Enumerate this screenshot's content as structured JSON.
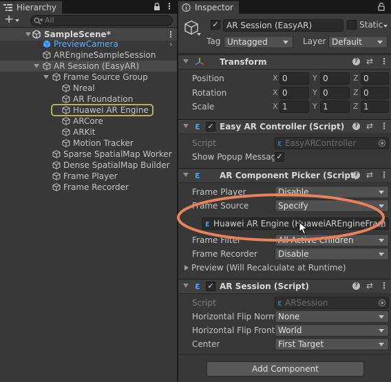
{
  "hierarchy": {
    "tab_label": "Hierarchy",
    "search_placeholder": "All",
    "add_label": "+",
    "scene_name": "SampleScene*",
    "items": [
      {
        "label": "PreviewCamera"
      },
      {
        "label": "AREngineSampleSession"
      },
      {
        "label": "AR Session (EasyAR)"
      },
      {
        "label": "Frame Source Group"
      },
      {
        "label": "Nreal"
      },
      {
        "label": "AR Foundation"
      },
      {
        "label": "Huawei AR Engine"
      },
      {
        "label": "ARCore"
      },
      {
        "label": "ARKit"
      },
      {
        "label": "Motion Tracker"
      },
      {
        "label": "Sparse SpatialMap Worker"
      },
      {
        "label": "Dense SpatialMap Builder"
      },
      {
        "label": "Frame Player"
      },
      {
        "label": "Frame Recorder"
      }
    ]
  },
  "inspector": {
    "tab_label": "Inspector",
    "object_name": "AR Session (EasyAR)",
    "static_label": "Static",
    "tag_label": "Tag",
    "tag_value": "Untagged",
    "layer_label": "Layer",
    "layer_value": "Default",
    "transform": {
      "title": "Transform",
      "rows": [
        {
          "label": "Position",
          "x": "0",
          "y": "0",
          "z": "0"
        },
        {
          "label": "Rotation",
          "x": "0",
          "y": "0",
          "z": "0"
        },
        {
          "label": "Scale",
          "x": "1",
          "y": "1",
          "z": "1"
        }
      ],
      "axis_x": "X",
      "axis_y": "Y",
      "axis_z": "Z"
    },
    "easyar_controller": {
      "title": "Easy AR Controller (Script)",
      "script_label": "Script",
      "script_value": "EasyARController",
      "popup_label": "Show Popup Messag",
      "popup_checked": "✓"
    },
    "component_picker": {
      "title": "AR Component Picker (Script)",
      "frame_player_label": "Frame Player",
      "frame_player_value": "Disable",
      "frame_source_label": "Frame Source",
      "frame_source_value": "Specify",
      "frame_source_object": "Huawei AR Engine (HuaweiAREngineFram",
      "frame_filter_label": "Frame Filter",
      "frame_filter_value": "All Active Children",
      "frame_recorder_label": "Frame Recorder",
      "frame_recorder_value": "Disable",
      "preview_label": "Preview (Will Recalculate at Runtime)"
    },
    "ar_session": {
      "title": "AR Session (Script)",
      "script_label": "Script",
      "script_value": "ARSession",
      "hflip_normal_label": "Horizontal Flip Norma",
      "hflip_normal_value": "None",
      "hflip_front_label": "Horizontal Flip Front",
      "hflip_front_value": "World",
      "center_label": "Center",
      "center_value": "First Target"
    },
    "add_component_label": "Add Component"
  },
  "colors": {
    "selection_outline": "#b8b35a",
    "annotation_ellipse": "#e8825a",
    "prefab_blue": "#4aa0ff"
  }
}
